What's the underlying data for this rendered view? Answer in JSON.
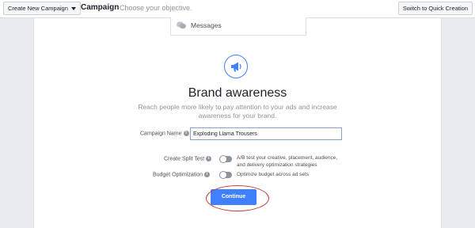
{
  "topbar": {
    "create_label": "Create New Campaign",
    "title": "Campaign",
    "subtitle": "Choose your objective.",
    "switch_label": "Switch to Quick Creation"
  },
  "objective_list": {
    "messages_label": "Messages"
  },
  "objective": {
    "title": "Brand awareness",
    "description": "Reach people more likely to pay attention to your ads and increase awareness for your brand."
  },
  "form": {
    "campaign_name_label": "Campaign Name",
    "campaign_name_value": "Exploding Llama Trousers",
    "split_test_label": "Create Split Test",
    "split_test_desc": "A/B test your creative, placement, audience, and delivery optimization strategies",
    "budget_label": "Budget Optimization",
    "budget_desc": "Optimize budget across ad sets",
    "continue_label": "Continue"
  },
  "colors": {
    "accent": "#4080ff",
    "highlight_ring": "#c23a3a"
  }
}
